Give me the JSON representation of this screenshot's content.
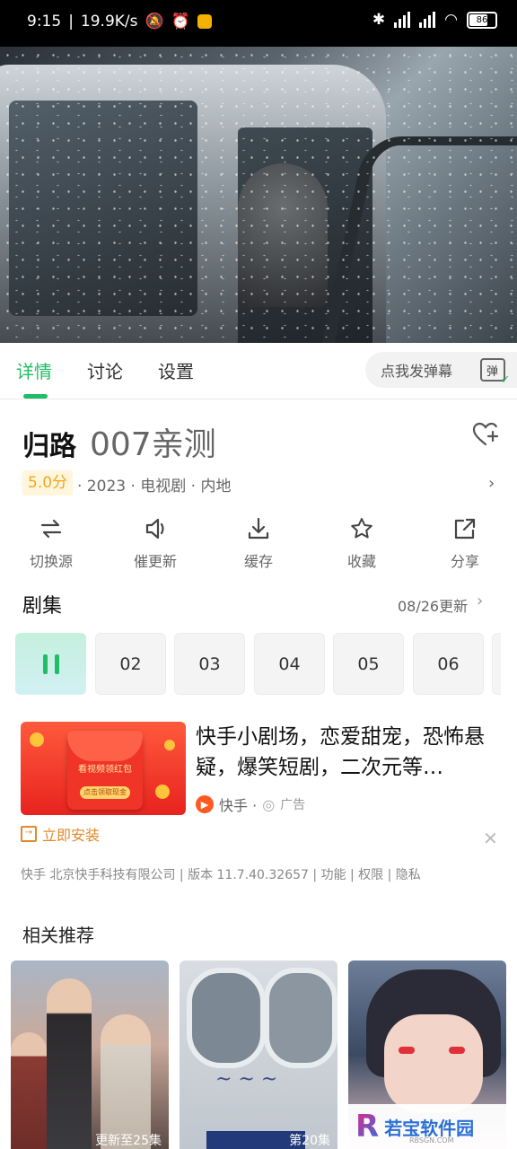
{
  "status_bar": {
    "time": "9:15",
    "speed": "19.9K/s",
    "battery": "86"
  },
  "tabs": [
    {
      "label": "详情",
      "active": true
    },
    {
      "label": "讨论",
      "active": false
    },
    {
      "label": "设置",
      "active": false
    }
  ],
  "danmaku": {
    "send_label": "点我发弹幕",
    "toggle_label": "弹"
  },
  "show": {
    "title": "归路",
    "subtitle": "007亲测",
    "score": "5.0分",
    "meta": "· 2023 · 电视剧 · 内地"
  },
  "actions": [
    {
      "label": "切换源",
      "icon": "switch-source-icon"
    },
    {
      "label": "催更新",
      "icon": "speaker-icon"
    },
    {
      "label": "缓存",
      "icon": "download-icon"
    },
    {
      "label": "收藏",
      "icon": "star-icon"
    },
    {
      "label": "分享",
      "icon": "share-icon"
    }
  ],
  "episodes": {
    "section_title": "剧集",
    "update_text": "08/26更新",
    "items": [
      "02",
      "03",
      "04",
      "05",
      "06"
    ]
  },
  "ad": {
    "title": "快手小剧场，恋爱甜宠，恐怖悬疑，爆笑短剧，二次元等…",
    "source": "快手 ·",
    "tag": "广告",
    "install": "立即安装",
    "image_banner": "看视频领红包",
    "image_button": "点击领取现金",
    "company": "快手 北京快手科技有限公司 | 版本 11.7.40.32657 | 功能 | 权限 | 隐私"
  },
  "recommend": {
    "title": "相关推荐",
    "posters": [
      {
        "caption": "更新至25集"
      },
      {
        "caption": "第20集"
      },
      {
        "caption": ""
      }
    ]
  },
  "watermark": {
    "text": "若宝软件园",
    "small": "RBSGN.COM"
  },
  "colors": {
    "accent": "#1fbd66",
    "score_text": "#f2a61b",
    "install": "#e08a2a"
  }
}
